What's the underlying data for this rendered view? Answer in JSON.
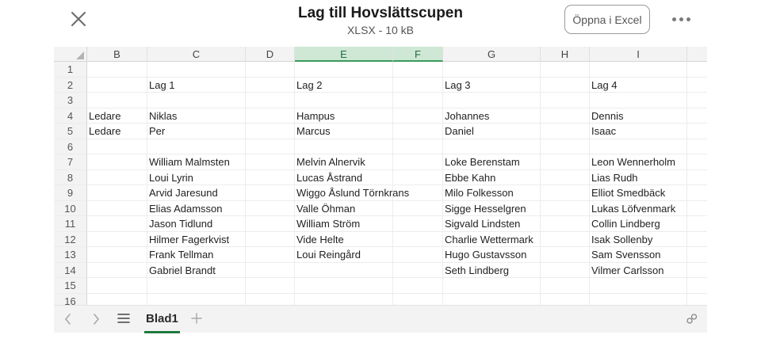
{
  "header": {
    "title": "Lag till Hovslättscupen",
    "subtitle": "XLSX - 10 kB",
    "open_button": "Öppna i Excel",
    "close_icon": "close-icon",
    "more_icon": "more-horizontal-icon"
  },
  "sheet": {
    "columns": [
      "B",
      "C",
      "D",
      "E",
      "F",
      "G",
      "H",
      "I"
    ],
    "selected_columns": [
      "E",
      "F"
    ],
    "row_numbers": [
      "1",
      "2",
      "3",
      "4",
      "5",
      "6",
      "7",
      "8",
      "9",
      "10",
      "11",
      "12",
      "13",
      "14",
      "15",
      "16"
    ],
    "rows": [
      [
        "",
        "",
        "",
        "",
        "",
        "",
        "",
        ""
      ],
      [
        "",
        "Lag 1",
        "",
        "Lag 2",
        "",
        "Lag 3",
        "",
        "Lag 4"
      ],
      [
        "",
        "",
        "",
        "",
        "",
        "",
        "",
        ""
      ],
      [
        "Ledare",
        "Niklas",
        "",
        "Hampus",
        "",
        "Johannes",
        "",
        "Dennis"
      ],
      [
        "Ledare",
        "Per",
        "",
        "Marcus",
        "",
        "Daniel",
        "",
        "Isaac"
      ],
      [
        "",
        "",
        "",
        "",
        "",
        "",
        "",
        ""
      ],
      [
        "",
        "William Malmsten",
        "",
        "Melvin Alnervik",
        "",
        "Loke Berenstam",
        "",
        "Leon Wennerholm"
      ],
      [
        "",
        "Loui Lyrin",
        "",
        "Lucas Åstrand",
        "",
        "Ebbe Kahn",
        "",
        "Lias Rudh"
      ],
      [
        "",
        "Arvid Jaresund",
        "",
        "Wiggo Åslund Törnkrans",
        "",
        "Milo Folkesson",
        "",
        "Elliot Smedbäck"
      ],
      [
        "",
        "Elias Adamsson",
        "",
        "Valle Öhman",
        "",
        "Sigge Hesselgren",
        "",
        "Lukas Löfvenmark"
      ],
      [
        "",
        "Jason Tidlund",
        "",
        "William Ström",
        "",
        "Sigvald Lindsten",
        "",
        "Collin Lindberg"
      ],
      [
        "",
        "Hilmer Fagerkvist",
        "",
        "Vide Helte",
        "",
        "Charlie Wettermark",
        "",
        "Isak Sollenby"
      ],
      [
        "",
        "Frank Tellman",
        "",
        "Loui Reingård",
        "",
        "Hugo Gustavsson",
        "",
        "Sam Svensson"
      ],
      [
        "",
        "Gabriel Brandt",
        "",
        "",
        "",
        "Seth Lindberg",
        "",
        "Vilmer Carlsson"
      ],
      [
        "",
        "",
        "",
        "",
        "",
        "",
        "",
        ""
      ],
      [
        "",
        "",
        "",
        "",
        "",
        "",
        "",
        ""
      ]
    ]
  },
  "bottom_bar": {
    "sheet_tab": "Blad1",
    "prev_icon": "chevron-left-icon",
    "next_icon": "chevron-right-icon",
    "list_icon": "sheet-list-icon",
    "add_icon": "add-sheet-icon",
    "share_icon": "share-icon"
  },
  "colors": {
    "accent": "#1f7a3f",
    "selected_header": "#cfe8d5"
  }
}
